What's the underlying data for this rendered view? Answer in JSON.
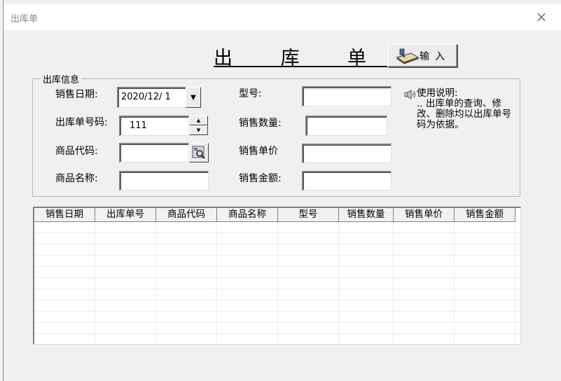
{
  "window": {
    "title": "出库单",
    "close": "×"
  },
  "form": {
    "heading": "出 库 单",
    "input_button": {
      "label": "输入",
      "icon": "keyboard-hand-icon"
    },
    "group_title": "出库信息",
    "fields": {
      "sale_date": {
        "label": "销售日期:",
        "value": "2020/12/ 1"
      },
      "order_no": {
        "label": "出库单号码:",
        "value": "111"
      },
      "product_code": {
        "label": "商品代码:",
        "value": ""
      },
      "product_name": {
        "label": "商品名称:",
        "value": ""
      },
      "model": {
        "label": "型号:",
        "value": ""
      },
      "quantity": {
        "label": "销售数量:",
        "value": ""
      },
      "unit_price": {
        "label": "销售单价",
        "value": ""
      },
      "amount": {
        "label": "销售金额:",
        "value": ""
      }
    },
    "usage": {
      "title": "使用说明:",
      "text": ".. 出库单的查询、修改、删除均以出库单号码为依据。"
    }
  },
  "grid": {
    "columns": [
      "销售日期",
      "出库单号",
      "商品代码",
      "商品名称",
      "型号",
      "销售数量",
      "销售单价",
      "销售金额"
    ]
  }
}
